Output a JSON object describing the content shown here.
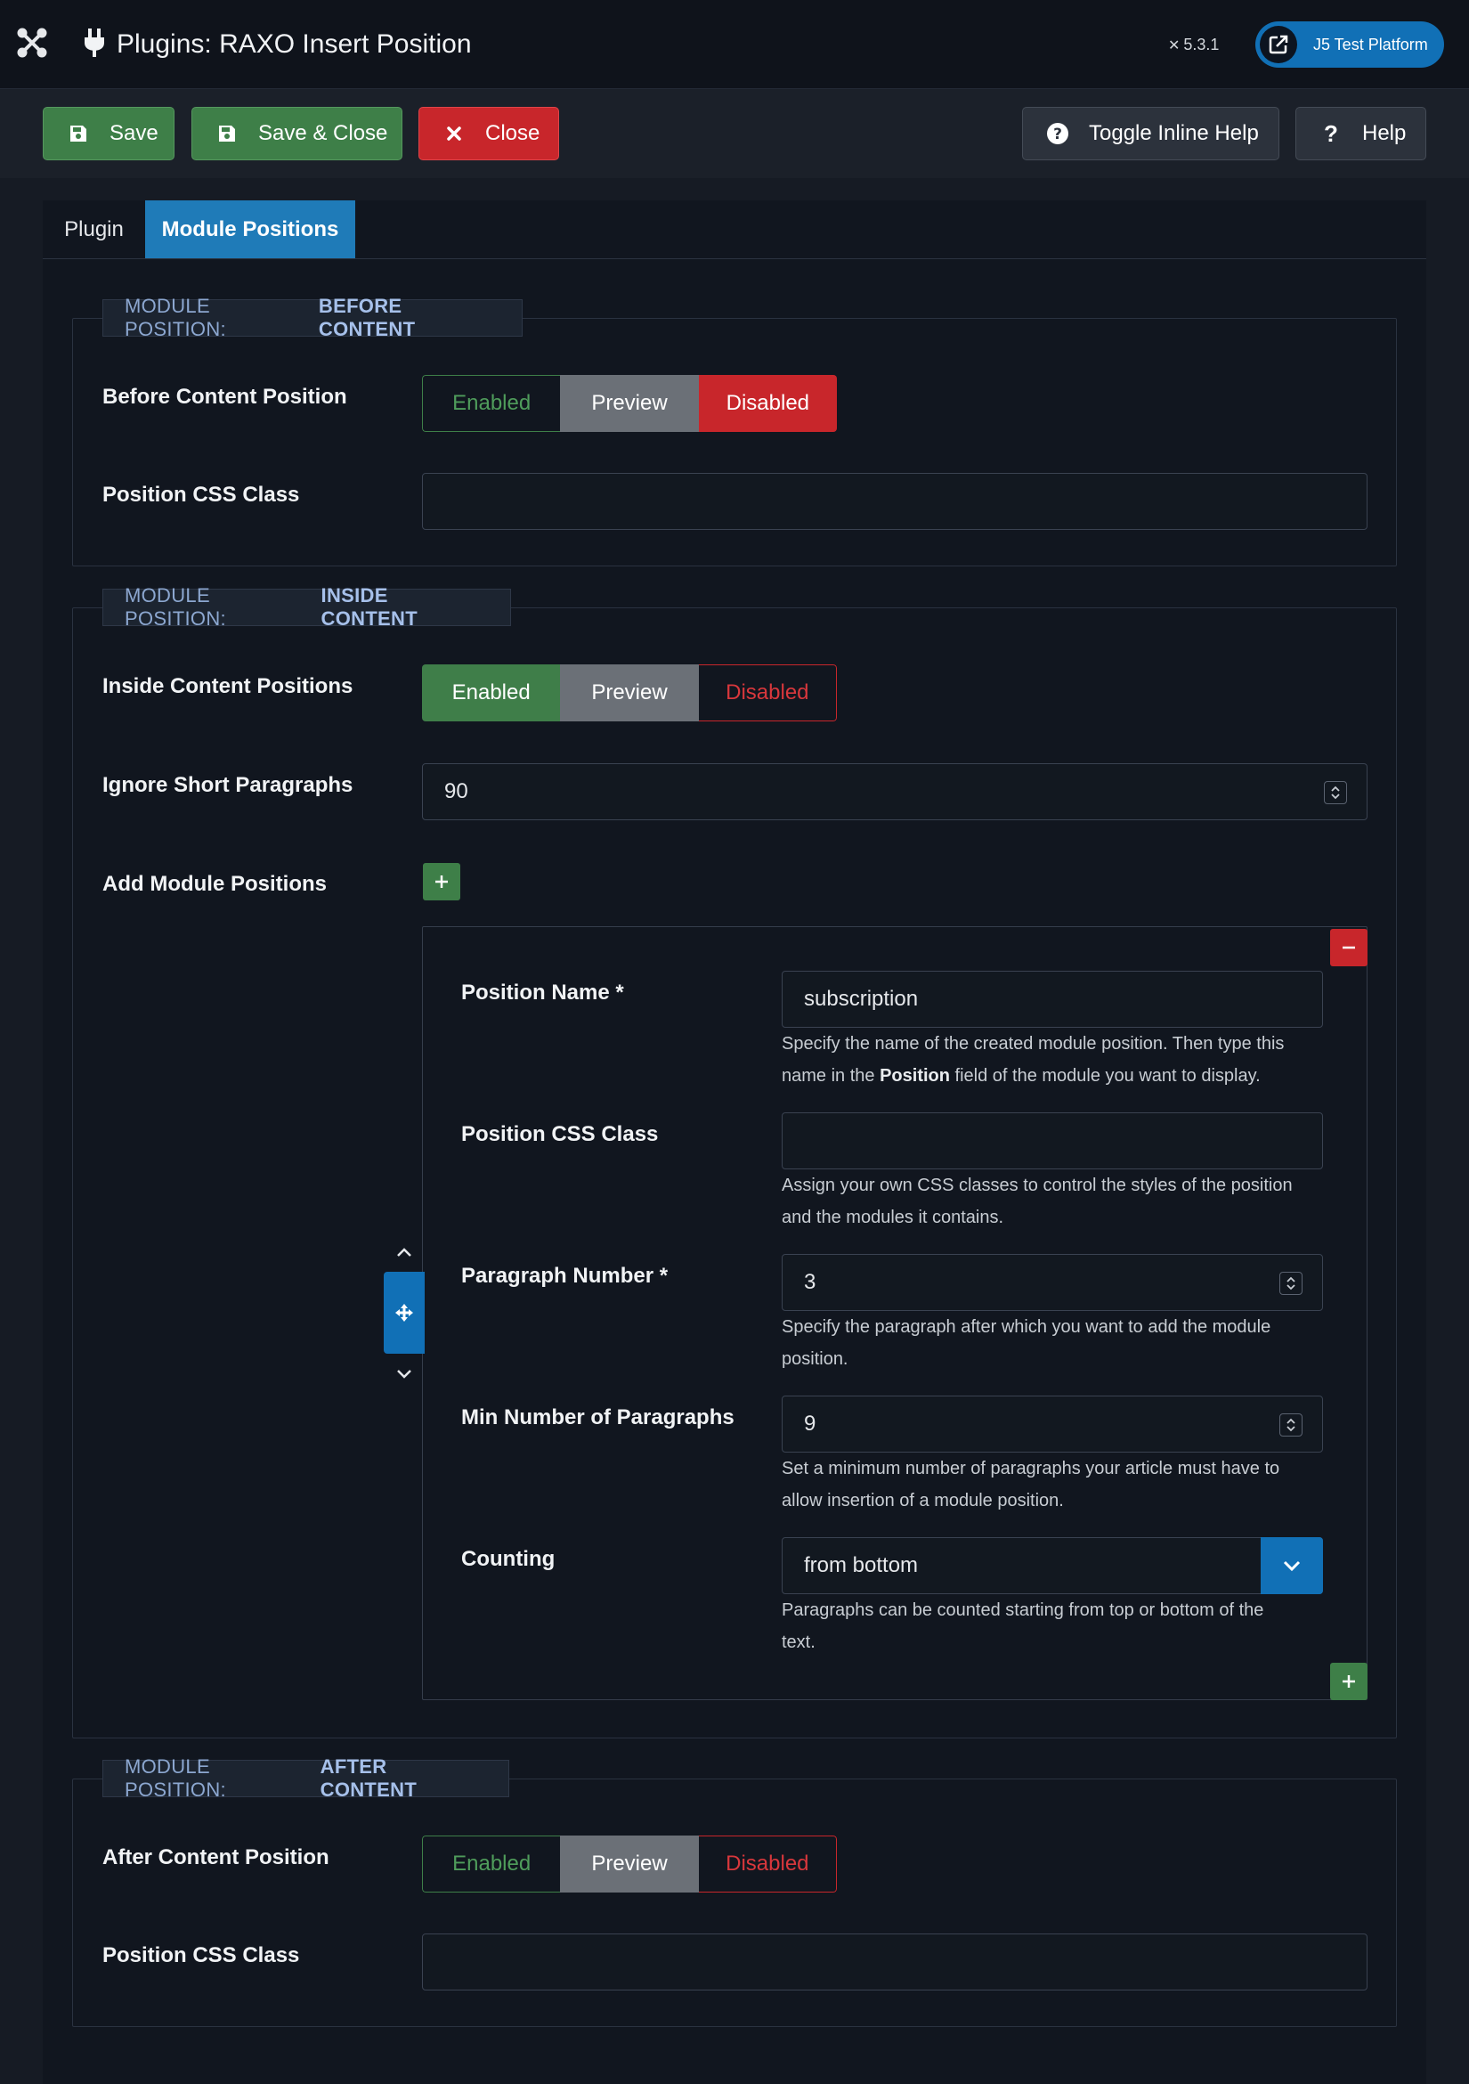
{
  "header": {
    "title": "Plugins: RAXO Insert Position",
    "version": "5.3.1",
    "site_button": "J5 Test Platform"
  },
  "toolbar": {
    "save": "Save",
    "save_close": "Save & Close",
    "close": "Close",
    "toggle_help": "Toggle Inline Help",
    "help": "Help"
  },
  "tabs": [
    {
      "label": "Plugin",
      "active": false
    },
    {
      "label": "Module Positions",
      "active": true
    }
  ],
  "before": {
    "legend_prefix": "MODULE POSITION:",
    "legend_strong": "BEFORE CONTENT",
    "position_label": "Before Content Position",
    "switch": {
      "enabled": "Enabled",
      "preview": "Preview",
      "disabled": "Disabled",
      "selected": "Disabled"
    },
    "css_label": "Position CSS Class",
    "css_value": ""
  },
  "inside": {
    "legend_prefix": "MODULE POSITION:",
    "legend_strong": "INSIDE CONTENT",
    "positions_label": "Inside Content Positions",
    "switch": {
      "enabled": "Enabled",
      "preview": "Preview",
      "disabled": "Disabled",
      "selected": "Enabled"
    },
    "ignore_label": "Ignore Short Paragraphs",
    "ignore_value": "90",
    "add_label": "Add Module Positions",
    "row": {
      "name_label": "Position Name *",
      "name_value": "subscription",
      "name_help_pre": "Specify the name of the created module position. Then type this",
      "name_help_mid1": "name in the ",
      "name_help_bold": "Position",
      "name_help_mid2": " field of the module you want to display.",
      "css_label": "Position CSS Class",
      "css_value": "",
      "css_help_1": "Assign your own CSS classes to control the styles of the position",
      "css_help_2": "and the modules it contains.",
      "para_label": "Paragraph Number *",
      "para_value": "3",
      "para_help_1": "Specify the paragraph after which you want to add the module",
      "para_help_2": "position.",
      "min_label": "Min Number of Paragraphs",
      "min_value": "9",
      "min_help_1": "Set a minimum number of paragraphs your article must have to",
      "min_help_2": "allow insertion of a module position.",
      "count_label": "Counting",
      "count_value": "from bottom",
      "count_help_1": "Paragraphs can be counted starting from top or bottom of the",
      "count_help_2": "text."
    }
  },
  "after": {
    "legend_prefix": "MODULE POSITION:",
    "legend_strong": "AFTER CONTENT",
    "position_label": "After Content Position",
    "switch": {
      "enabled": "Enabled",
      "preview": "Preview",
      "disabled": "Disabled",
      "selected": "Preview"
    },
    "css_label": "Position CSS Class",
    "css_value": ""
  },
  "colors": {
    "accent": "#1170b6",
    "success": "#3e7f48",
    "danger": "#c8262b",
    "legend_text": "#8ca7d0"
  },
  "icons": [
    "joomla-logo-icon",
    "plug-icon",
    "external-link-icon",
    "save-icon",
    "close-x-icon",
    "question-circle-icon",
    "question-icon",
    "plus-icon",
    "minus-icon",
    "move-icon",
    "chevron-up-icon",
    "chevron-down-icon",
    "spinner-arrows-icon"
  ]
}
